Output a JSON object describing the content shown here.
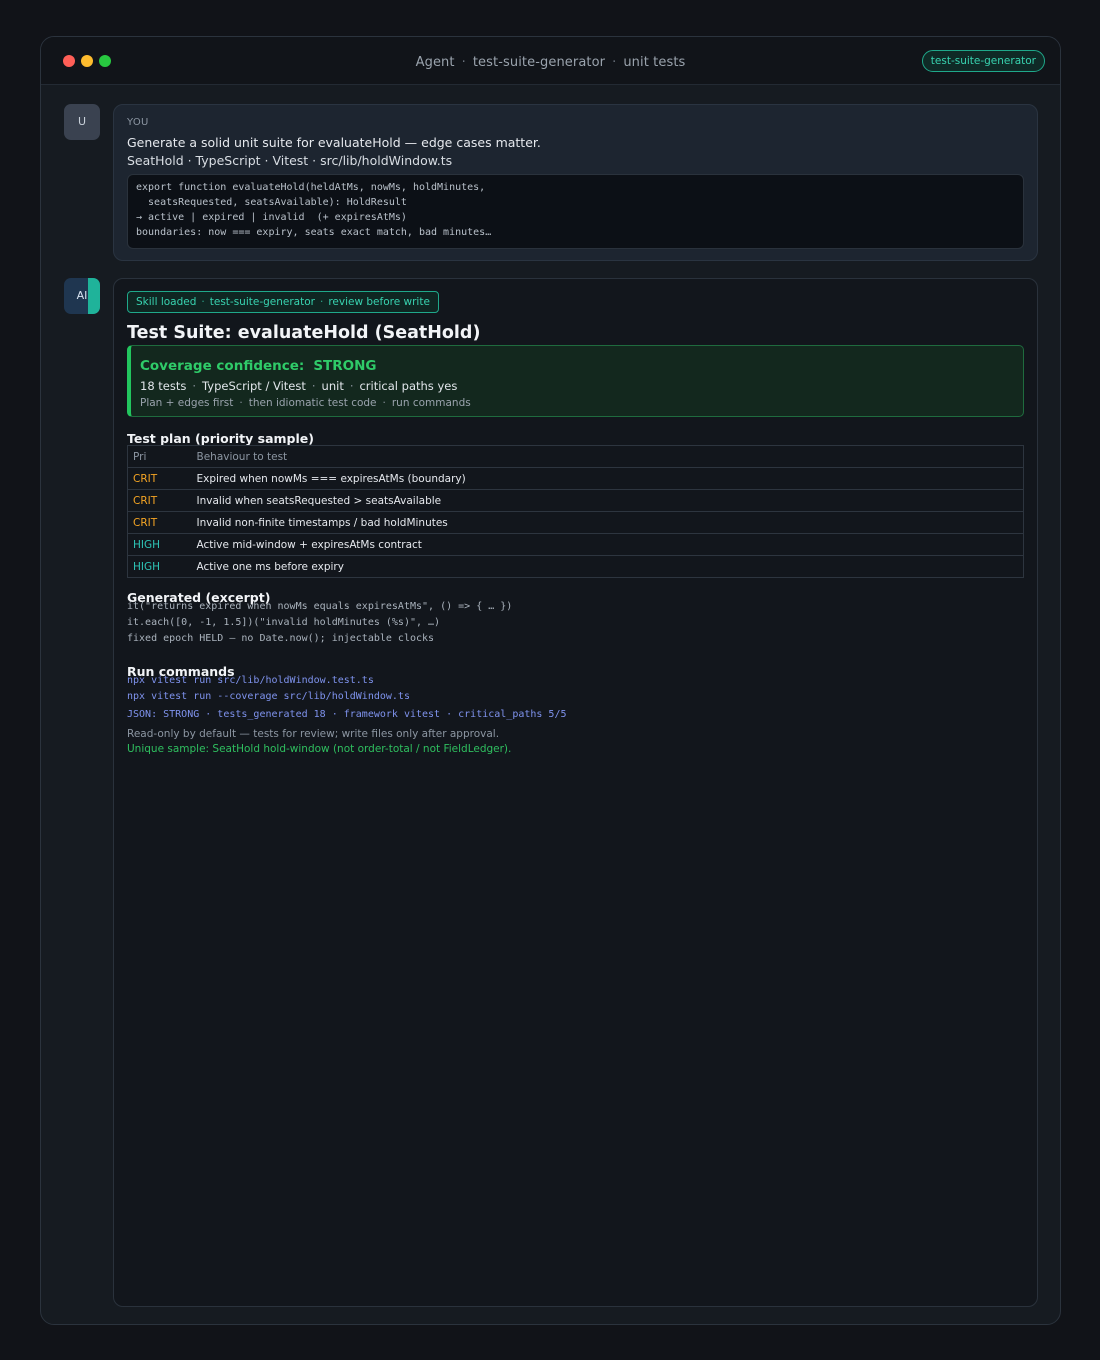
{
  "window": {
    "title_parts": [
      "Agent",
      "test-suite-generator",
      "unit tests"
    ],
    "skill_pill": "test-suite-generator"
  },
  "user": {
    "avatar": "U",
    "label": "YOU",
    "prompt": "Generate a solid unit suite for evaluateHold — edge cases matter.",
    "meta": "SeatHold · TypeScript · Vitest · src/lib/holdWindow.ts",
    "code_lines": [
      "export function evaluateHold(heldAtMs, nowMs, holdMinutes,",
      "  seatsRequested, seatsAvailable): HoldResult",
      "→ active | expired | invalid  (+ expiresAtMs)",
      "boundaries: now === expiry, seats exact match, bad minutes…"
    ]
  },
  "ai": {
    "avatar": "AI",
    "skill_tag": [
      "Skill loaded",
      "test-suite-generator",
      "review before write"
    ],
    "suite_title": "Test Suite: evaluateHold (SeatHold)",
    "coverage": {
      "label": "Coverage confidence:",
      "value": "STRONG",
      "stats": [
        "18 tests",
        "TypeScript / Vitest",
        "unit",
        "critical paths yes"
      ],
      "sub": [
        "Plan + edges first",
        "then idiomatic test code",
        "run commands"
      ]
    },
    "plan": {
      "heading": "Test plan (priority sample)",
      "columns": [
        "Pri",
        "Behaviour to test"
      ],
      "rows": [
        {
          "pri": "CRIT",
          "behaviour": "Expired when nowMs === expiresAtMs (boundary)"
        },
        {
          "pri": "CRIT",
          "behaviour": "Invalid when seatsRequested > seatsAvailable"
        },
        {
          "pri": "CRIT",
          "behaviour": "Invalid non-finite timestamps / bad holdMinutes"
        },
        {
          "pri": "HIGH",
          "behaviour": "Active mid-window + expiresAtMs contract"
        },
        {
          "pri": "HIGH",
          "behaviour": "Active one ms before expiry"
        }
      ]
    },
    "generated": {
      "heading": "Generated (excerpt)",
      "lines": [
        "it(\"returns expired when nowMs equals expiresAtMs\", () => { … })",
        "it.each([0, -1, 1.5])(\"invalid holdMinutes (%s)\", …)",
        "fixed epoch HELD — no Date.now(); injectable clocks"
      ]
    },
    "run": {
      "heading": "Run commands",
      "commands": [
        "npx vitest run src/lib/holdWindow.test.ts",
        "npx vitest run --coverage src/lib/holdWindow.ts"
      ],
      "json_line": "JSON: STRONG · tests_generated 18 · framework vitest · critical_paths 5/5",
      "note": "Read-only by default — tests for review; write files only after approval.",
      "unique": "Unique sample: SeatHold hold-window (not order-total / not FieldLedger)."
    }
  },
  "colors": {
    "accent_teal": "#38d3b0",
    "coverage_green": "#2fcb69",
    "crit": "#f5a524",
    "high": "#2ec4b6",
    "command": "#7f93ee"
  }
}
